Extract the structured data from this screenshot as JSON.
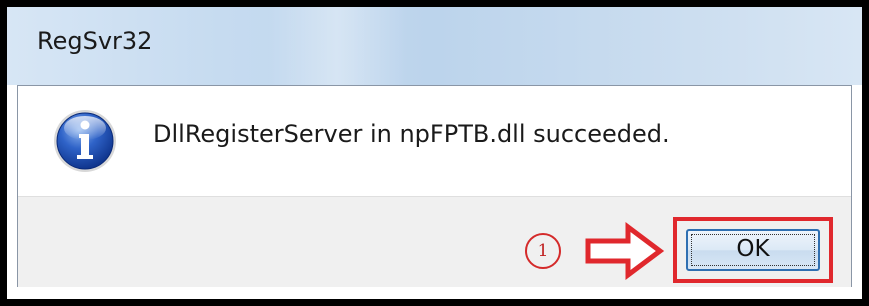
{
  "window": {
    "title": "RegSvr32"
  },
  "dialog": {
    "icon": "info-icon",
    "message": "DllRegisterServer in npFPTB.dll succeeded."
  },
  "annotation": {
    "step_marker": "1",
    "arrow_icon": "right-arrow-icon",
    "highlight_color": "#e0282d"
  },
  "buttons": {
    "ok_label": "OK"
  }
}
